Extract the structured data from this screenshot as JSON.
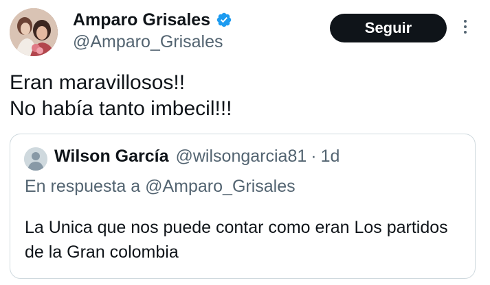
{
  "author": {
    "display_name": "Amparo Grisales",
    "handle": "@Amparo_Grisales",
    "verified_icon": "verified-badge-icon",
    "verified_color": "#1d9bf0"
  },
  "actions": {
    "follow_label": "Seguir",
    "more_icon": "more-vertical-icon"
  },
  "tweet": {
    "lines": [
      "Eran maravillosos!!",
      "No había tanto imbecil!!!"
    ]
  },
  "quoted_tweet": {
    "display_name": "Wilson García",
    "handle": "@wilsongarcia81",
    "separator": "·",
    "time": "1d",
    "reply_prefix": "En respuesta a",
    "reply_to_handle": "@Amparo_Grisales",
    "text": "La Unica que nos puede contar como eran Los partidos de la Gran colombia"
  },
  "colors": {
    "text_primary": "#0f1419",
    "text_secondary": "#536471",
    "button_bg": "#0f1419",
    "border": "#cfd9de"
  }
}
